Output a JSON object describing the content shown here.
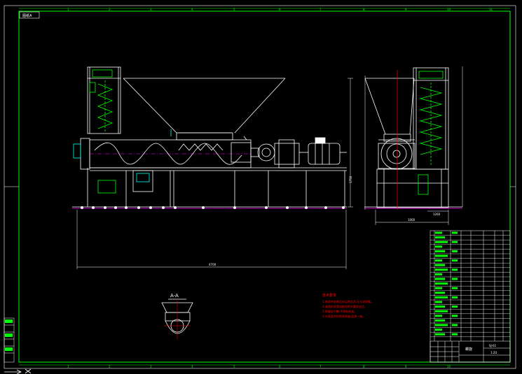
{
  "colors": {
    "background": "#000000",
    "frame": "#ffffff",
    "border_green": "#00ff00",
    "machine_white": "#ffffff",
    "cyan": "#00ffff",
    "yellow": "#ffff00",
    "red": "#ff0000",
    "magenta": "#ff00ff"
  },
  "drawing": {
    "corner_tag": "图纸A",
    "ruler_top": [
      "1",
      "2",
      "3",
      "4",
      "5",
      "6",
      "7",
      "8",
      "9",
      "10",
      "11",
      "12"
    ],
    "ruler_bottom": [
      "1",
      "2",
      "3",
      "4",
      "5",
      "6",
      "7",
      "8",
      "9",
      "10",
      "11",
      "12"
    ],
    "dimension_overall": "4700",
    "dimension_height": "1750",
    "side_dim_width": "1060",
    "side_dim_base": "1260",
    "section_label": "A-A",
    "notes_title": "技术要求",
    "notes_lines": [
      "1.各部件安装后应运转灵活,无卡滞现象。",
      "2.减速机润滑油按说明书要求加注。",
      "3.焊缝应平整,不得有夹渣。",
      "4.外表面涂防锈漆两遍,面漆一遍。"
    ],
    "title_block": {
      "title": "螺旋",
      "code": "SJ-01",
      "scale": "1:20"
    }
  }
}
